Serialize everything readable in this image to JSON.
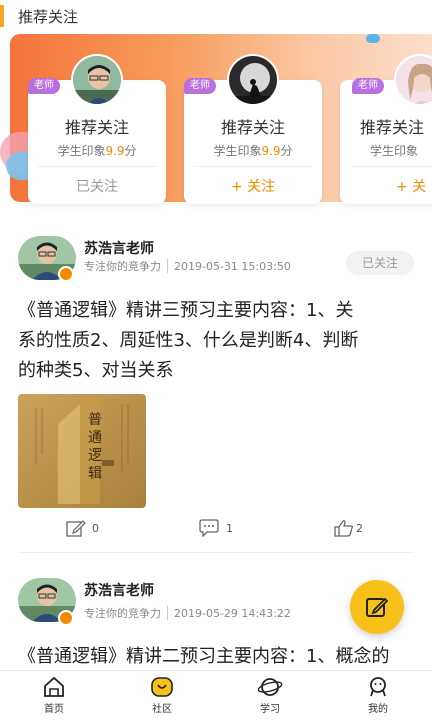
{
  "header": {
    "title": "推荐关注"
  },
  "recommend_cards": [
    {
      "tag": "老师",
      "name": "推荐关注",
      "score_label": "学生印象",
      "score": "9.9",
      "score_unit": "分",
      "follow_label": "已关注",
      "followed": true
    },
    {
      "tag": "老师",
      "name": "推荐关注",
      "score_label": "学生印象",
      "score": "9.9",
      "score_unit": "分",
      "follow_label": "+ 关注",
      "followed": false
    },
    {
      "tag": "老师",
      "name": "推荐关注",
      "score_label": "学生印象",
      "score": "",
      "score_unit": "",
      "follow_label": "+ 关",
      "followed": false
    }
  ],
  "posts": [
    {
      "author": "苏浩言老师",
      "slogan": "专注你的竞争力",
      "time": "2019-05-31 15:03:50",
      "follow_label": "已关注",
      "text_lines": [
        "《普通逻辑》精讲三预习主要内容：1、关",
        "系的性质2、周延性3、什么是判断4、判断",
        "的种类5、对当关系"
      ],
      "book_title": "普通逻辑",
      "stats": {
        "edit": "0",
        "comments": "1",
        "likes": "2"
      }
    },
    {
      "author": "苏浩言老师",
      "slogan": "专注你的竞争力",
      "time": "2019-05-29 14:43:22",
      "text_lines": [
        "《普通逻辑》精讲二预习主要内容：1、概念的"
      ]
    }
  ],
  "tabbar": {
    "items": [
      {
        "label": "首页"
      },
      {
        "label": "社区"
      },
      {
        "label": "学习"
      },
      {
        "label": "我的"
      }
    ]
  },
  "colors": {
    "accent": "#f08a00",
    "fab": "#f7c11a",
    "tag": "#b86fe0"
  }
}
